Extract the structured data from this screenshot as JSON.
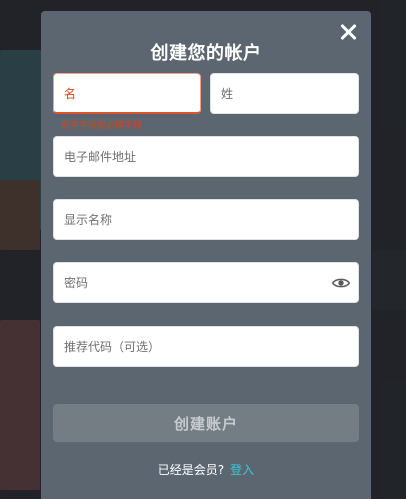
{
  "modal": {
    "title": "创建您的帐户",
    "fields": {
      "first_name": {
        "placeholder": "名",
        "error": "名字字段是必填字段"
      },
      "last_name": {
        "placeholder": "姓"
      },
      "email": {
        "placeholder": "电子邮件地址"
      },
      "display_name": {
        "placeholder": "显示名称"
      },
      "password": {
        "placeholder": "密码"
      },
      "referral": {
        "placeholder": "推荐代码（可选）"
      }
    },
    "submit_label": "创建账户",
    "login_prompt": "已经是会员?",
    "login_link": "登入"
  },
  "colors": {
    "modal_bg": "#5c6670",
    "error": "#d3441c",
    "link": "#37c9dd",
    "submit_disabled": "#747c84"
  },
  "icons": [
    "close-icon",
    "eye-icon"
  ]
}
